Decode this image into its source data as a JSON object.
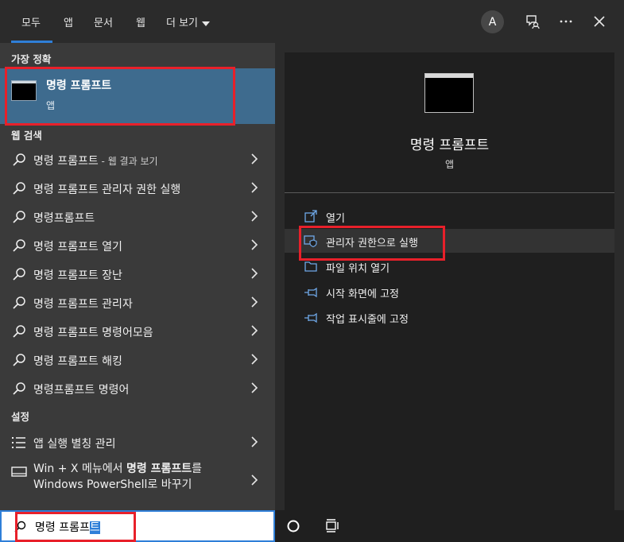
{
  "tabs": [
    {
      "label": "모두",
      "active": true
    },
    {
      "label": "앱"
    },
    {
      "label": "문서"
    },
    {
      "label": "웹"
    },
    {
      "label": "더 보기"
    }
  ],
  "topbar": {
    "avatar_letter": "A",
    "icons": [
      "feedback-icon",
      "more-icon",
      "close-icon"
    ]
  },
  "best_match": {
    "section": "가장 정확",
    "title": "명령 프롬프트",
    "subtitle": "앱"
  },
  "web_search": {
    "section": "웹 검색",
    "items": [
      {
        "label": "명령 프롬프트",
        "suffix": " - 웹 결과 보기"
      },
      {
        "label": "명령 프롬프트 관리자 권한 실행"
      },
      {
        "label": "명령프롬프트"
      },
      {
        "label": "명령 프롬프트 열기"
      },
      {
        "label": "명령 프롬프트 장난"
      },
      {
        "label": "명령 프롬프트 관리자"
      },
      {
        "label": "명령 프롬프트 명령어모음"
      },
      {
        "label": "명령 프롬프트 해킹"
      },
      {
        "label": "명령프롬프트 명령어"
      }
    ]
  },
  "settings": {
    "section": "설정",
    "items": [
      {
        "label": "앱 실행 별칭 관리"
      },
      {
        "line1_pre": "Win + X 메뉴에서 ",
        "line1_bold": "명령 프롬프트",
        "line1_post": "를",
        "line2": "Windows PowerShell로 바꾸기"
      }
    ]
  },
  "search": {
    "typed": "명령 프롬프",
    "selected": "트"
  },
  "preview": {
    "title": "명령 프롬프트",
    "subtitle": "앱",
    "actions": [
      {
        "label": "열기",
        "icon": "open-icon"
      },
      {
        "label": "관리자 권한으로 실행",
        "icon": "shield-icon"
      },
      {
        "label": "파일 위치 열기",
        "icon": "folder-icon"
      },
      {
        "label": "시작 화면에 고정",
        "icon": "pin-icon"
      },
      {
        "label": "작업 표시줄에 고정",
        "icon": "pin-icon"
      }
    ]
  },
  "colors": {
    "accent": "#2f7fd8",
    "highlight": "#e8202a",
    "best_bg": "#3e6b8e"
  }
}
